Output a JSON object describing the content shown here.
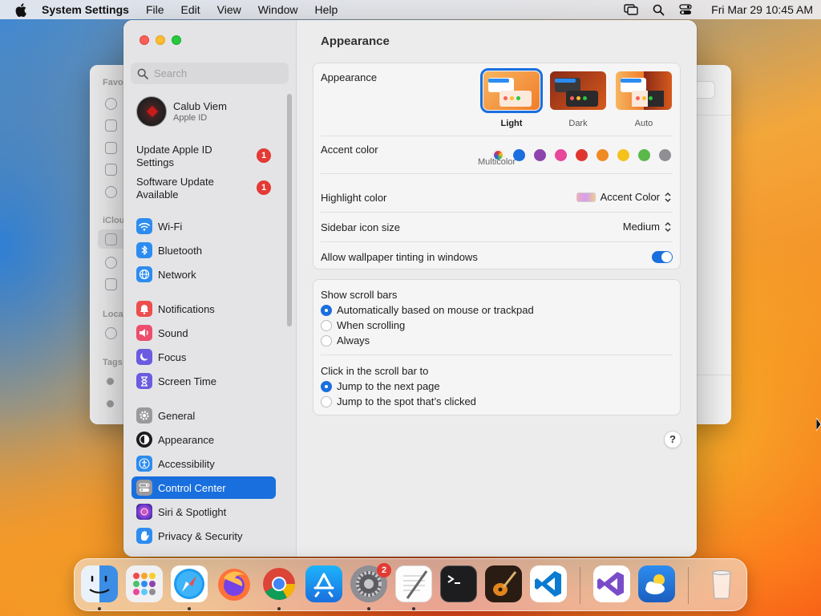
{
  "menubar": {
    "app_name": "System Settings",
    "items": [
      "File",
      "Edit",
      "View",
      "Window",
      "Help"
    ],
    "clock": "Fri Mar 29  10:45 AM"
  },
  "finder_sidebar": {
    "labels": [
      "Favo",
      "iClou",
      "Loca",
      "Tags"
    ]
  },
  "sidebar": {
    "search_placeholder": "Search",
    "account": {
      "name": "Calub Viem",
      "subtitle": "Apple ID"
    },
    "notices": [
      {
        "line1": "Update Apple ID",
        "line2": "Settings",
        "badge": "1"
      },
      {
        "line1": "Software Update",
        "line2": "Available",
        "badge": "1"
      }
    ],
    "items": [
      {
        "label": "Wi-Fi",
        "icon": "wifi-icon",
        "color": "#2d8cf0"
      },
      {
        "label": "Bluetooth",
        "icon": "bluetooth-icon",
        "color": "#2d8cf0"
      },
      {
        "label": "Network",
        "icon": "globe-icon",
        "color": "#2d8cf0"
      },
      {
        "label": "Notifications",
        "icon": "bell-icon",
        "color": "#ee4d4d"
      },
      {
        "label": "Sound",
        "icon": "speaker-icon",
        "color": "#ee4d6d"
      },
      {
        "label": "Focus",
        "icon": "moon-icon",
        "color": "#6a5be0"
      },
      {
        "label": "Screen Time",
        "icon": "hourglass-icon",
        "color": "#6a5be0"
      },
      {
        "label": "General",
        "icon": "gear-icon",
        "color": "#9a9a9e"
      },
      {
        "label": "Appearance",
        "icon": "appearance-icon",
        "color": "#1d1d1f"
      },
      {
        "label": "Accessibility",
        "icon": "accessibility-icon",
        "color": "#2d8cf0"
      },
      {
        "label": "Control Center",
        "icon": "control-center-icon",
        "color": "#9a9a9e"
      },
      {
        "label": "Siri & Spotlight",
        "icon": "siri-icon",
        "color": "#c23ab8"
      },
      {
        "label": "Privacy & Security",
        "icon": "hand-icon",
        "color": "#2d8cf0"
      }
    ],
    "selected": "Control Center"
  },
  "content": {
    "title": "Appearance",
    "appearance_label": "Appearance",
    "appearance_options": [
      "Light",
      "Dark",
      "Auto"
    ],
    "appearance_selected": "Light",
    "accent_label": "Accent color",
    "accent_colors": [
      "multicolor",
      "#1a6fde",
      "#8e44ad",
      "#e8479b",
      "#e0352f",
      "#f08a24",
      "#f5c21b",
      "#5ab94a",
      "#8e8e93"
    ],
    "accent_caption": "Multicolor",
    "highlight_label": "Highlight color",
    "highlight_value": "Accent Color",
    "sidebar_icon_label": "Sidebar icon size",
    "sidebar_icon_value": "Medium",
    "tinting_label": "Allow wallpaper tinting in windows",
    "tinting_on": true,
    "scroll_bars_label": "Show scroll bars",
    "scroll_bars_options": [
      "Automatically based on mouse or trackpad",
      "When scrolling",
      "Always"
    ],
    "scroll_bars_selected": 0,
    "click_label": "Click in the scroll bar to",
    "click_options": [
      "Jump to the next page",
      "Jump to the spot that’s clicked"
    ],
    "click_selected": 0,
    "help": "?"
  },
  "dock": {
    "apps": [
      {
        "name": "Finder",
        "icon": "finder-icon",
        "running": true
      },
      {
        "name": "Launchpad",
        "icon": "launchpad-icon",
        "running": false
      },
      {
        "name": "Safari",
        "icon": "safari-icon",
        "running": true
      },
      {
        "name": "Firefox",
        "icon": "firefox-icon",
        "running": false
      },
      {
        "name": "Chrome",
        "icon": "chrome-icon",
        "running": true
      },
      {
        "name": "App Store",
        "icon": "app-store-icon",
        "running": false
      },
      {
        "name": "System Settings",
        "icon": "system-settings-icon",
        "running": true,
        "badge": "2"
      },
      {
        "name": "TextEdit",
        "icon": "textedit-icon",
        "running": true
      },
      {
        "name": "Terminal",
        "icon": "terminal-icon",
        "running": false
      },
      {
        "name": "GarageBand",
        "icon": "garageband-icon",
        "running": false
      },
      {
        "name": "Visual Studio Code",
        "icon": "vscode-icon",
        "running": false
      },
      {
        "name": "Visual Studio",
        "icon": "visual-studio-icon",
        "running": false
      },
      {
        "name": "Weather",
        "icon": "weather-icon",
        "running": false
      },
      {
        "name": "Trash",
        "icon": "trash-icon",
        "running": false
      }
    ]
  }
}
